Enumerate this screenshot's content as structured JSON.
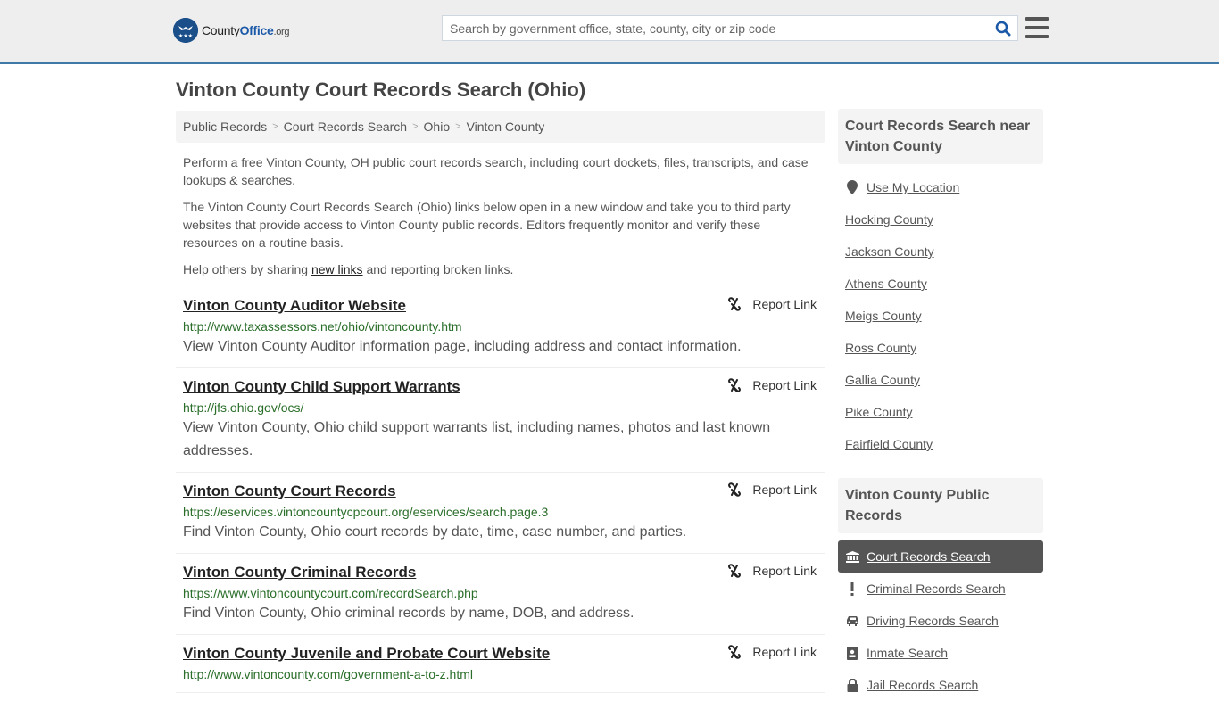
{
  "header": {
    "logo": {
      "name_part1": "County",
      "name_part2": "Office",
      "tld": ".org"
    },
    "search_placeholder": "Search by government office, state, county, city or zip code",
    "search_value": ""
  },
  "page_title": "Vinton County Court Records Search (Ohio)",
  "breadcrumb": [
    {
      "label": "Public Records"
    },
    {
      "label": "Court Records Search"
    },
    {
      "label": "Ohio"
    },
    {
      "label": "Vinton County"
    }
  ],
  "intro": {
    "p1": "Perform a free Vinton County, OH public court records search, including court dockets, files, transcripts, and case lookups & searches.",
    "p2": "The Vinton County Court Records Search (Ohio) links below open in a new window and take you to third party websites that provide access to Vinton County public records. Editors frequently monitor and verify these resources on a routine basis.",
    "p3_before": "Help others by sharing ",
    "p3_link": "new links",
    "p3_after": " and reporting broken links."
  },
  "report_label": "Report Link",
  "results": [
    {
      "title": "Vinton County Auditor Website",
      "url": "http://www.taxassessors.net/ohio/vintoncounty.htm",
      "description": "View Vinton County Auditor information page, including address and contact information."
    },
    {
      "title": "Vinton County Child Support Warrants",
      "url": "http://jfs.ohio.gov/ocs/",
      "description": "View Vinton County, Ohio child support warrants list, including names, photos and last known addresses."
    },
    {
      "title": "Vinton County Court Records",
      "url": "https://eservices.vintoncountycpcourt.org/eservices/search.page.3",
      "description": "Find Vinton County, Ohio court records by date, time, case number, and parties."
    },
    {
      "title": "Vinton County Criminal Records",
      "url": "https://www.vintoncountycourt.com/recordSearch.php",
      "description": "Find Vinton County, Ohio criminal records by name, DOB, and address."
    },
    {
      "title": "Vinton County Juvenile and Probate Court Website",
      "url": "http://www.vintoncounty.com/government-a-to-z.html",
      "description": ""
    }
  ],
  "sidebar": {
    "nearby_heading": "Court Records Search near Vinton County",
    "use_location": "Use My Location",
    "nearby": [
      {
        "label": "Hocking County"
      },
      {
        "label": "Jackson County"
      },
      {
        "label": "Athens County"
      },
      {
        "label": "Meigs County"
      },
      {
        "label": "Ross County"
      },
      {
        "label": "Gallia County"
      },
      {
        "label": "Pike County"
      },
      {
        "label": "Fairfield County"
      }
    ],
    "records_heading": "Vinton County Public Records",
    "records": [
      {
        "label": "Court Records Search",
        "icon": "courthouse-icon",
        "active": true
      },
      {
        "label": "Criminal Records Search",
        "icon": "exclamation-icon",
        "active": false
      },
      {
        "label": "Driving Records Search",
        "icon": "car-icon",
        "active": false
      },
      {
        "label": "Inmate Search",
        "icon": "id-badge-icon",
        "active": false
      },
      {
        "label": "Jail Records Search",
        "icon": "lock-icon",
        "active": false
      }
    ]
  },
  "colors": {
    "brand_blue": "#1b4f8a",
    "header_border": "#3f79a8",
    "url_green": "#2a6e2a",
    "active_nav_bg": "#555555"
  }
}
